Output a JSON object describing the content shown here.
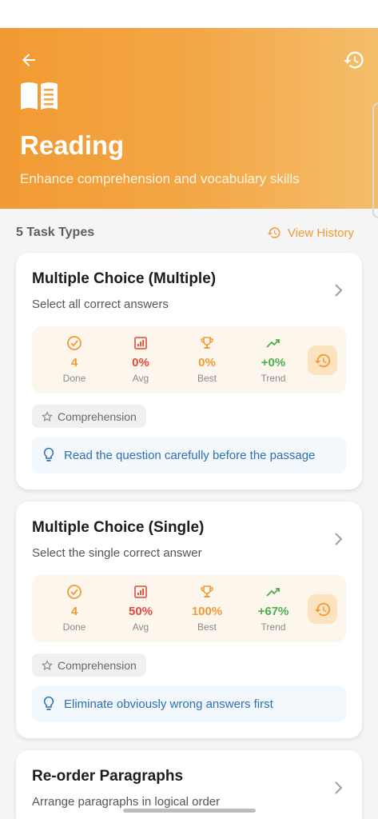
{
  "header": {
    "title": "Reading",
    "subtitle": "Enhance comprehension and vocabulary skills"
  },
  "summary": {
    "count_label": "5 Task Types",
    "view_history_label": "View History"
  },
  "stat_labels": {
    "done": "Done",
    "avg": "Avg",
    "best": "Best",
    "trend": "Trend"
  },
  "cards": [
    {
      "title": "Multiple Choice (Multiple)",
      "subtitle": "Select all correct answers",
      "done": "4",
      "avg": "0%",
      "best": "0%",
      "trend": "+0%",
      "tag": "Comprehension",
      "tip": "Read the question carefully before the passage"
    },
    {
      "title": "Multiple Choice (Single)",
      "subtitle": "Select the single correct answer",
      "done": "4",
      "avg": "50%",
      "best": "100%",
      "trend": "+67%",
      "tag": "Comprehension",
      "tip": "Eliminate obviously wrong answers first"
    },
    {
      "title": "Re-order Paragraphs",
      "subtitle": "Arrange paragraphs in logical order"
    }
  ],
  "colors": {
    "accent": "#f29a33",
    "avg_red": "#e04b3a",
    "trend_green": "#4caf50",
    "tip_blue": "#2f6fb3"
  },
  "icons": {
    "back": "arrow-left-icon",
    "history": "history-icon",
    "book": "book-icon",
    "done": "check-circle-icon",
    "avg": "bar-chart-icon",
    "best": "trophy-icon",
    "trend": "trending-up-icon",
    "tag": "star-icon",
    "tip": "lightbulb-icon",
    "chevron": "chevron-right-icon"
  }
}
